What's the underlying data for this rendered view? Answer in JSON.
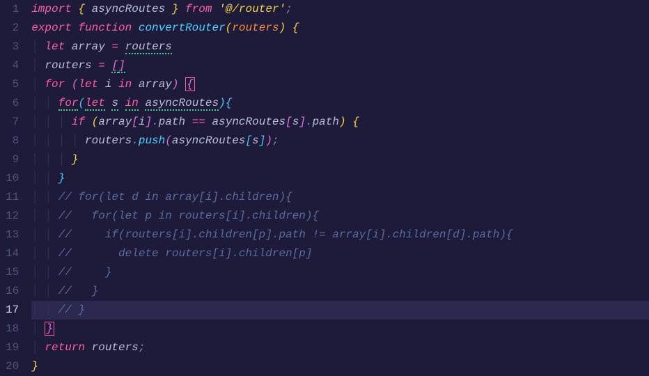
{
  "lines": {
    "numbers": [
      "1",
      "2",
      "3",
      "4",
      "5",
      "6",
      "7",
      "8",
      "9",
      "10",
      "11",
      "12",
      "13",
      "14",
      "15",
      "16",
      "17",
      "18",
      "19",
      "20"
    ],
    "activeLine": 17
  },
  "code": {
    "l1": {
      "import": "import",
      "lbrace": "{",
      "asyncRoutes": "asyncRoutes",
      "rbrace": "}",
      "from": "from",
      "path": "'@/router'",
      "semi": ";"
    },
    "l2": {
      "export": "export",
      "function": "function",
      "name": "convertRouter",
      "lp": "(",
      "param": "routers",
      "rp": ")",
      "lbrace": "{"
    },
    "l3": {
      "let": "let",
      "array": "array",
      "eq": "=",
      "routers": "routers"
    },
    "l4": {
      "routers": "routers",
      "eq": "=",
      "lb": "[",
      "rb": "]"
    },
    "l5": {
      "for": "for",
      "lp": "(",
      "let": "let",
      "i": "i",
      "in": "in",
      "array": "array",
      "rp": ")",
      "lbrace": "{"
    },
    "l6": {
      "for": "for",
      "lp": "(",
      "let": "let",
      "s": "s",
      "in": "in",
      "asyncRoutes": "asyncRoutes",
      "rp": ")",
      "lbrace": "{"
    },
    "l7": {
      "if": "if",
      "lp": "(",
      "array": "array",
      "lb1": "[",
      "i": "i",
      "rb1": "]",
      "dot1": ".",
      "path1": "path",
      "eqeq": "==",
      "asyncRoutes": "asyncRoutes",
      "lb2": "[",
      "s": "s",
      "rb2": "]",
      "dot2": ".",
      "path2": "path",
      "rp": ")",
      "lbrace": "{"
    },
    "l8": {
      "routers": "routers",
      "dot": ".",
      "push": "push",
      "lp": "(",
      "asyncRoutes": "asyncRoutes",
      "lb": "[",
      "s": "s",
      "rb": "]",
      "rp": ")",
      "semi": ";"
    },
    "l9": {
      "rbrace": "}"
    },
    "l10": {
      "rbrace": "}"
    },
    "l11": {
      "text": "// for(let d in array[i].children){"
    },
    "l12": {
      "text": "//   for(let p in routers[i].children){"
    },
    "l13": {
      "text": "//     if(routers[i].children[p].path != array[i].children[d].path){"
    },
    "l14": {
      "text": "//       delete routers[i].children[p]"
    },
    "l15": {
      "text": "//     }"
    },
    "l16": {
      "text": "//   }"
    },
    "l17": {
      "text": "// }"
    },
    "l18": {
      "rbrace": "}"
    },
    "l19": {
      "return": "return",
      "routers": "routers",
      "semi": ";"
    },
    "l20": {
      "rbrace": "}"
    }
  }
}
